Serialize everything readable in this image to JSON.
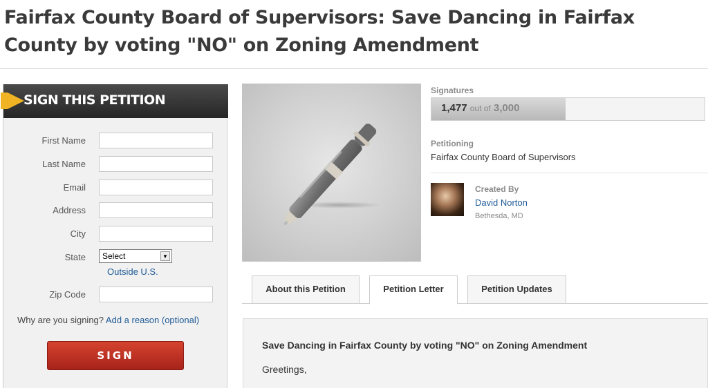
{
  "page": {
    "title": "Fairfax County Board of Supervisors: Save Dancing in Fairfax County by voting \"NO\" on Zoning Amendment"
  },
  "sign_panel": {
    "header": "SIGN THIS PETITION",
    "fields": {
      "first_name": {
        "label": "First Name",
        "value": ""
      },
      "last_name": {
        "label": "Last Name",
        "value": ""
      },
      "email": {
        "label": "Email",
        "value": ""
      },
      "address": {
        "label": "Address",
        "value": ""
      },
      "city": {
        "label": "City",
        "value": ""
      },
      "state": {
        "label": "State",
        "selected": "Select"
      },
      "zip": {
        "label": "Zip Code",
        "value": ""
      }
    },
    "outside_us_link": "Outside U.S.",
    "why_prompt": "Why are you signing?",
    "add_reason_link": "Add a reason (optional)",
    "sign_button": "SIGN"
  },
  "signatures": {
    "label": "Signatures",
    "count": "1,477",
    "out_of": "out of",
    "goal": "3,000",
    "progress_fraction": 0.4923
  },
  "petitioning": {
    "label": "Petitioning",
    "target": "Fairfax County Board of Supervisors"
  },
  "creator": {
    "label": "Created By",
    "name": "David Norton",
    "location": "Bethesda, MD"
  },
  "tabs": [
    {
      "label": "About this Petition",
      "active": false
    },
    {
      "label": "Petition Letter",
      "active": true
    },
    {
      "label": "Petition Updates",
      "active": false
    }
  ],
  "letter": {
    "title": "Save Dancing in Fairfax County by voting \"NO\" on Zoning Amendment",
    "greeting": "Greetings,"
  },
  "colors": {
    "accent_flag": "#f0b323",
    "sign_button": "#c0392b",
    "link": "#1e5a96"
  },
  "icons": {
    "petition_image": "pen-icon",
    "state_dropdown": "chevron-down-icon"
  }
}
